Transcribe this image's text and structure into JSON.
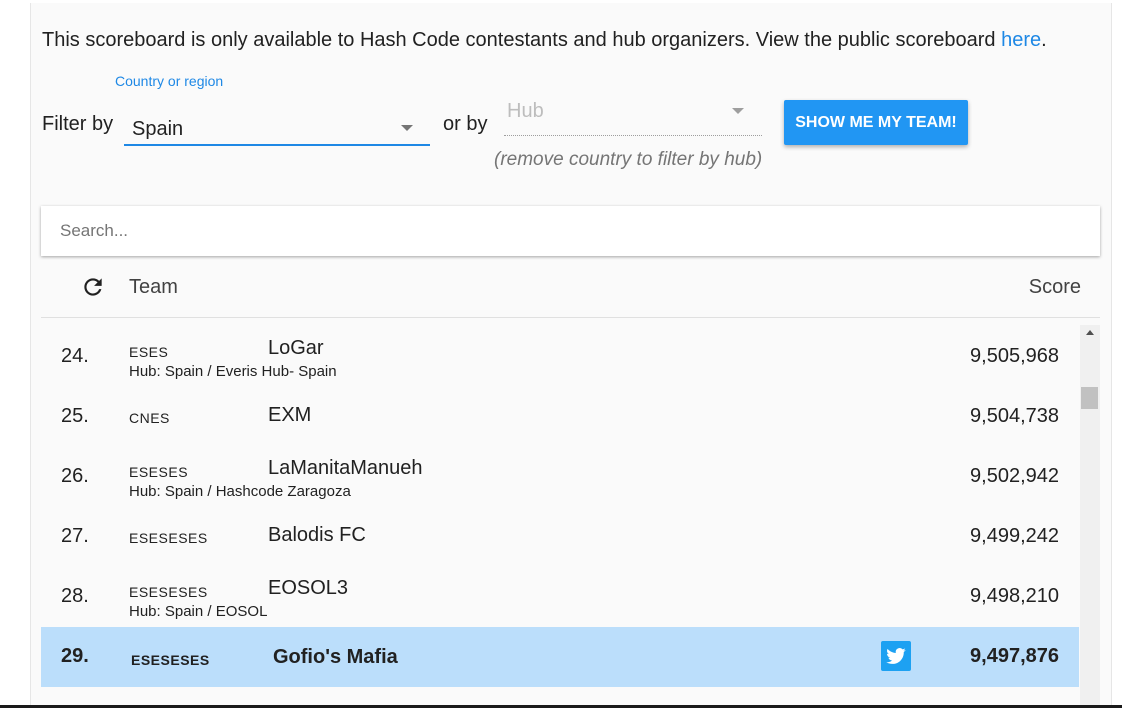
{
  "notice": {
    "text": "This scoreboard is only available to Hash Code contestants and hub organizers. View the public scoreboard ",
    "link": "here",
    "end": "."
  },
  "filter": {
    "label": "Filter by",
    "country_label": "Country or region",
    "country_value": "Spain",
    "or_by": "or by",
    "hub_placeholder": "Hub",
    "hub_hint": "(remove country to filter by hub)",
    "team_button": "SHOW ME MY TEAM!"
  },
  "search": {
    "placeholder": "Search..."
  },
  "table": {
    "headers": {
      "team": "Team",
      "score": "Score"
    },
    "rows": [
      {
        "rank": "24.",
        "flags": "ESES",
        "team": "LoGar",
        "hub": "Hub: Spain / Everis Hub- Spain",
        "score": "9,505,968"
      },
      {
        "rank": "25.",
        "flags": "CNES",
        "team": "EXM",
        "hub": "",
        "score": "9,504,738"
      },
      {
        "rank": "26.",
        "flags": "ESESES",
        "team": "LaManitaManueh",
        "hub": "Hub: Spain / Hashcode Zaragoza",
        "score": "9,502,942"
      },
      {
        "rank": "27.",
        "flags": "ESESESES",
        "team": "Balodis FC",
        "hub": "",
        "score": "9,499,242"
      },
      {
        "rank": "28.",
        "flags": "ESESESES",
        "team": "EOSOL3",
        "hub": "Hub: Spain / EOSOL",
        "score": "9,498,210"
      },
      {
        "rank": "29.",
        "flags": "ESESESES",
        "team": "Gofio's Mafia",
        "hub": "",
        "score": "9,497,876",
        "highlight": true,
        "twitter": true
      }
    ]
  },
  "colors": {
    "accent": "#1e88e5",
    "button": "#2196f3",
    "highlight_row": "#bbdefb",
    "twitter": "#1da1f2"
  },
  "icons": {
    "refresh": "refresh-icon",
    "twitter": "twitter-icon",
    "dropdown": "dropdown-caret-icon"
  }
}
